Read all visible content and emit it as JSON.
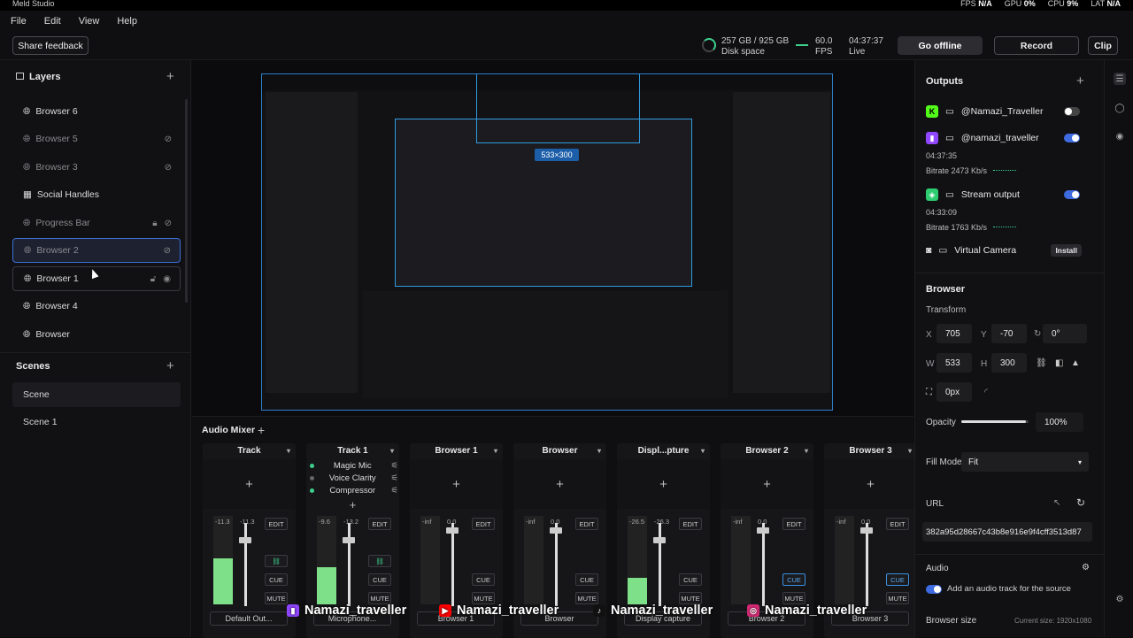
{
  "titlebar": {
    "app_title": "Meld Studio",
    "fps_label": "FPS",
    "fps_value": "N/A",
    "gpu_label": "GPU",
    "gpu_value": "0%",
    "cpu_label": "CPU",
    "cpu_value": "9%",
    "lat_label": "LAT",
    "lat_value": "N/A"
  },
  "menu": {
    "file": "File",
    "edit": "Edit",
    "view": "View",
    "help": "Help"
  },
  "toolbar": {
    "share_feedback": "Share feedback",
    "disk_value": "257 GB / 925 GB",
    "disk_label": "Disk space",
    "fps_value": "60.0",
    "fps_label": "FPS",
    "live_time": "04:37:37",
    "live_label": "Live",
    "go_offline": "Go offline",
    "record": "Record",
    "clip": "Clip"
  },
  "layers": {
    "title": "Layers",
    "items": [
      {
        "label": "Browser 6"
      },
      {
        "label": "Browser 5"
      },
      {
        "label": "Browser 3"
      },
      {
        "label": "Social Handles"
      },
      {
        "label": "Progress Bar"
      },
      {
        "label": "Browser 2"
      },
      {
        "label": "Browser 1"
      },
      {
        "label": "Browser 4"
      },
      {
        "label": "Browser"
      }
    ]
  },
  "scenes": {
    "title": "Scenes",
    "items": [
      {
        "label": "Scene"
      },
      {
        "label": "Scene 1"
      }
    ]
  },
  "canvas": {
    "selection_size": "533×300"
  },
  "mixer": {
    "title": "Audio Mixer",
    "strips": [
      {
        "name": "Track",
        "left_db": "-11.3",
        "right_db": "-11.3",
        "level": 0.52,
        "footer": "Default Out..."
      },
      {
        "name": "Track 1",
        "left_db": "-9.6",
        "right_db": "-13.2",
        "level": 0.42,
        "footer": "Microphone..."
      },
      {
        "name": "Browser 1",
        "left_db": "-inf",
        "right_db": "0.0",
        "level": 0,
        "footer": "Browser 1"
      },
      {
        "name": "Browser",
        "left_db": "-inf",
        "right_db": "0.0",
        "level": 0,
        "footer": "Browser"
      },
      {
        "name": "Displ...pture",
        "left_db": "-26.5",
        "right_db": "-26.3",
        "level": 0.3,
        "footer": "Display capture"
      },
      {
        "name": "Browser 2",
        "left_db": "-inf",
        "right_db": "0.0",
        "level": 0,
        "footer": "Browser 2"
      },
      {
        "name": "Browser 3",
        "left_db": "-inf",
        "right_db": "0.0",
        "level": 0,
        "footer": "Browser 3"
      }
    ],
    "effects": [
      "Magic Mic",
      "Voice Clarity",
      "Compressor"
    ],
    "edit": "EDIT",
    "cue": "CUE",
    "mute": "MUTE"
  },
  "overlay": {
    "handle": "Namazi_traveller"
  },
  "outputs": {
    "title": "Outputs",
    "items": [
      {
        "label": "@Namazi_Traveller",
        "brand_color": "#53fc18"
      },
      {
        "label": "@namazi_traveller",
        "brand_color": "#9146ff",
        "time": "04:37:35",
        "bitrate": "Bitrate  2473 Kb/s"
      },
      {
        "label": "Stream output",
        "brand_color": "#2ecc71",
        "time": "04:33:09",
        "bitrate": "Bitrate  1763 Kb/s"
      },
      {
        "label": "Virtual Camera",
        "install": "Install"
      }
    ]
  },
  "properties": {
    "title": "Browser",
    "transform": "Transform",
    "x_label": "X",
    "x": "705",
    "y_label": "Y",
    "y": "-70",
    "rot": "0°",
    "w_label": "W",
    "w": "533",
    "h_label": "H",
    "h": "300",
    "crop": "0px",
    "opacity_label": "Opacity",
    "opacity": "100%",
    "opacity_level": 0.96,
    "fill_label": "Fill Mode",
    "fill": "Fit",
    "url_label": "URL",
    "url": "382a95d28667c43b8e916e9f4cff3513d87",
    "audio_label": "Audio",
    "audio_text": "Add an audio track for the source",
    "browser_size": "Browser size",
    "current_size": "Current size: 1920x1080"
  }
}
